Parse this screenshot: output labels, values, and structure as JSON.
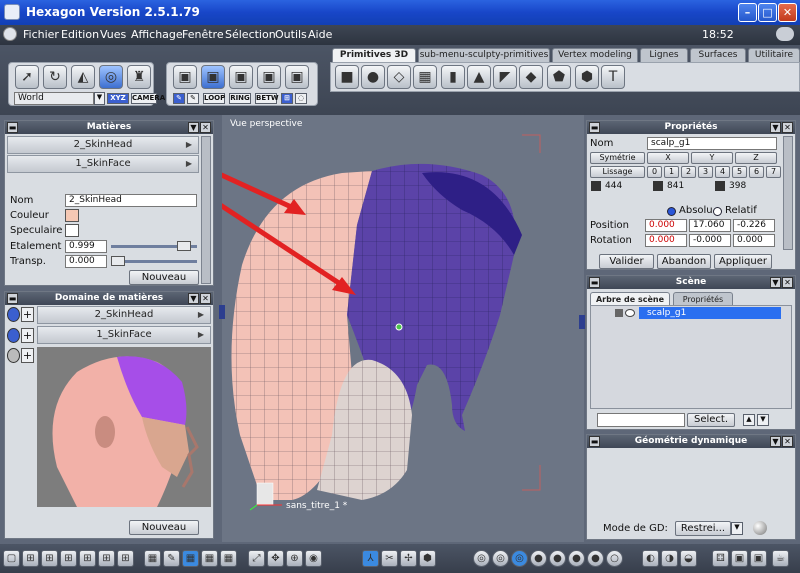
{
  "window": {
    "title": "Hexagon Version 2.5.1.79",
    "clock": "18:52"
  },
  "menu": [
    "Fichier",
    "Edition",
    "Vues",
    "Affichage",
    "Fenêtre",
    "Sélection",
    "Outils",
    "Aide"
  ],
  "toolbar": {
    "coord_select": "World",
    "xyz": "XYZ",
    "camera": "CAMERA",
    "sel_buttons": [
      "LOOP",
      "RING",
      "BETW"
    ],
    "tabs": [
      "Primitives 3D",
      "sub-menu-sculpty-primitives",
      "Vertex modeling",
      "Lignes",
      "Surfaces",
      "Utilitaire"
    ]
  },
  "materials": {
    "title": "Matières",
    "items": [
      "2_SkinHead",
      "1_SkinFace"
    ],
    "nom_label": "Nom",
    "nom_value": "2_SkinHead",
    "couleur_label": "Couleur",
    "couleur_color": "#f5c8b4",
    "speculaire_label": "Speculaire",
    "etalement_label": "Etalement",
    "etalement_value": "0.999",
    "transp_label": "Transp.",
    "transp_value": "0.000",
    "new_button": "Nouveau"
  },
  "domain": {
    "title": "Domaine de matières",
    "items": [
      "2_SkinHead",
      "1_SkinFace"
    ],
    "new_button": "Nouveau"
  },
  "viewport": {
    "label": "Vue perspective",
    "object_name": "sans_titre_1 *"
  },
  "properties": {
    "title": "Propriétés",
    "nom_label": "Nom",
    "nom_value": "scalp_g1",
    "symetrie": "Symétrie",
    "axes": [
      "X",
      "Y",
      "Z"
    ],
    "lissage": "Lissage",
    "levels": [
      "0",
      "1",
      "2",
      "3",
      "4",
      "5",
      "6",
      "7"
    ],
    "counts": [
      "444",
      "841",
      "398"
    ],
    "absolu": "Absolu",
    "relatif": "Relatif",
    "position_label": "Position",
    "position": [
      "0.000",
      "17.060",
      "-0.226"
    ],
    "rotation_label": "Rotation",
    "rotation": [
      "0.000",
      "-0.000",
      "0.000"
    ],
    "valider": "Valider",
    "abandon": "Abandon",
    "appliquer": "Appliquer"
  },
  "scene": {
    "title": "Scène",
    "tabs": [
      "Arbre de scène",
      "Propriétés"
    ],
    "item": "scalp_g1",
    "select_button": "Select."
  },
  "dyngeo": {
    "title": "Géométrie dynamique",
    "mode_label": "Mode de GD:",
    "mode_value": "Restrei..."
  }
}
